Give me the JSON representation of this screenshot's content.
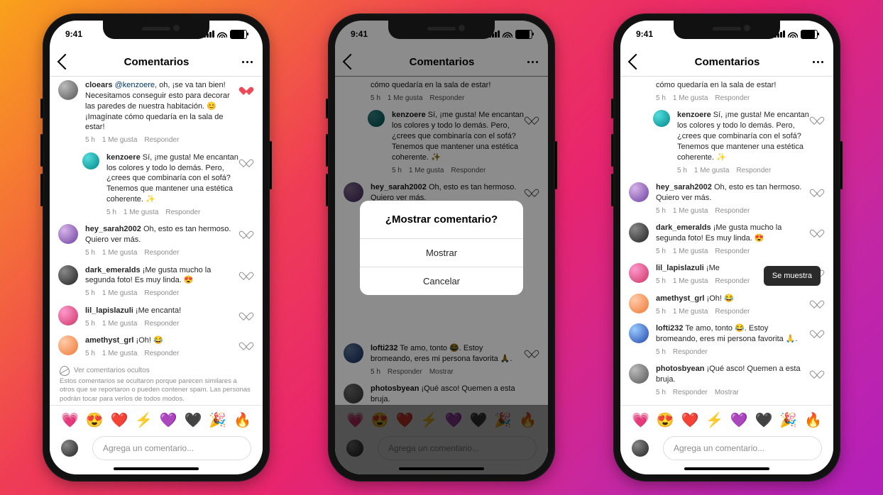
{
  "status": {
    "time": "9:41"
  },
  "nav": {
    "title": "Comentarios"
  },
  "composer": {
    "placeholder": "Agrega un comentario...",
    "emojis": [
      "💗",
      "😍",
      "❤️",
      "⚡",
      "💜",
      "🖤",
      "🎉",
      "🔥"
    ]
  },
  "meta": {
    "time": "5 h",
    "likes": "1 Me gusta",
    "reply": "Responder",
    "show": "Mostrar"
  },
  "hidden": {
    "title": "Ver comentarios ocultos",
    "note": "Estos comentarios se ocultaron porque parecen similares a otros que se reportaron o pueden contener spam. Las personas podrán tocar para verlos de todos modos."
  },
  "dialog": {
    "title": "¿Mostrar comentario?",
    "show": "Mostrar",
    "cancel": "Cancelar"
  },
  "toast": {
    "shown": "Se muestra"
  },
  "c": {
    "cloears": {
      "user": "cloears",
      "mention": "@kenzoere",
      "text": ", oh, ¡se va tan bien! Necesitamos conseguir esto para decorar las paredes de nuestra habitación. 😊 ¡Imagínate cómo quedaría en la sala de estar!"
    },
    "cloears_short": {
      "text": "cómo quedaría en la sala de estar!"
    },
    "kenzoere": {
      "user": "kenzoere",
      "text": "Sí, ¡me gusta! Me encantan los colores y todo lo demás. Pero, ¿crees que combinaría con el sofá? Tenemos que mantener una estética coherente. ✨"
    },
    "sarah": {
      "user": "hey_sarah2002",
      "text": "Oh, esto es tan hermoso. Quiero ver más."
    },
    "dark": {
      "user": "dark_emeralds",
      "text": "¡Me gusta mucho la segunda foto! Es muy linda. 😍"
    },
    "lil": {
      "user": "lil_lapislazuli",
      "text": "¡Me encanta!",
      "text_cut": "¡Me"
    },
    "amethyst": {
      "user": "amethyst_grl",
      "text": "¡Oh! 😂"
    },
    "lofti": {
      "user": "lofti232",
      "text": "Te amo, tonto 😂. Estoy bromeando, eres mi persona favorita 🙏."
    },
    "photos": {
      "user": "photosbyean",
      "text": "¡Qué asco! Quemen a esta bruja."
    }
  }
}
